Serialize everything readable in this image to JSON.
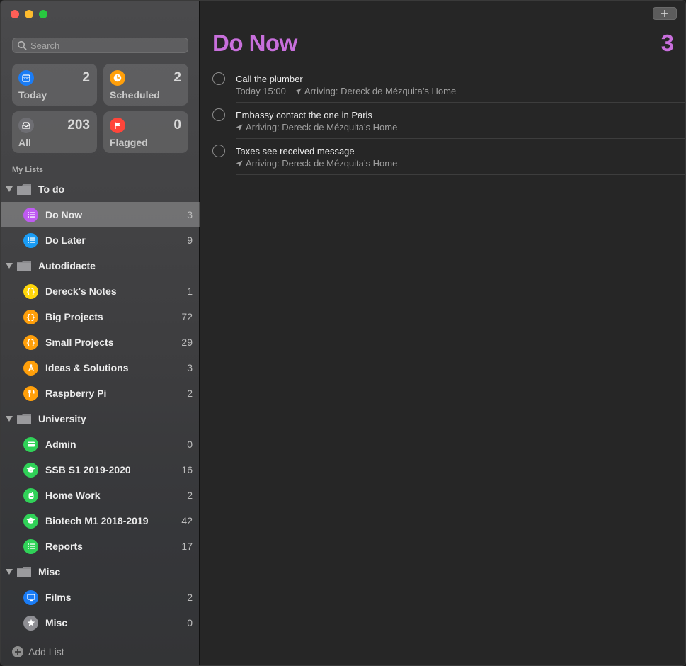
{
  "search": {
    "placeholder": "Search"
  },
  "smart_lists": [
    {
      "label": "Today",
      "count": "2",
      "color": "#1a7cf5",
      "icon": "calendar-icon"
    },
    {
      "label": "Scheduled",
      "count": "2",
      "color": "#ff9f0a",
      "icon": "clock-icon"
    },
    {
      "label": "All",
      "count": "203",
      "color": "#6e6e73",
      "icon": "tray-icon"
    },
    {
      "label": "Flagged",
      "count": "0",
      "color": "#ff453a",
      "icon": "flag-icon"
    }
  ],
  "my_lists_header": "My Lists",
  "groups": [
    {
      "label": "To do",
      "lists": [
        {
          "label": "Do Now",
          "count": "3",
          "color": "#bf5af2",
          "icon": "list-bullet-icon",
          "selected": true
        },
        {
          "label": "Do Later",
          "count": "9",
          "color": "#1a9cf5",
          "icon": "list-bullet-icon"
        }
      ]
    },
    {
      "label": "Autodidacte",
      "lists": [
        {
          "label": "Dereck's Notes",
          "count": "1",
          "color": "#ffd60a",
          "icon": "braces-icon"
        },
        {
          "label": "Big Projects",
          "count": "72",
          "color": "#ff9f0a",
          "icon": "braces-icon"
        },
        {
          "label": "Small Projects",
          "count": "29",
          "color": "#ff9f0a",
          "icon": "braces-icon"
        },
        {
          "label": "Ideas & Solutions",
          "count": "3",
          "color": "#ff9f0a",
          "icon": "compass-icon"
        },
        {
          "label": "Raspberry Pi",
          "count": "2",
          "color": "#ff9f0a",
          "icon": "utensils-icon"
        }
      ]
    },
    {
      "label": "University",
      "lists": [
        {
          "label": "Admin",
          "count": "0",
          "color": "#30d158",
          "icon": "card-icon"
        },
        {
          "label": "SSB S1 2019-2020",
          "count": "16",
          "color": "#30d158",
          "icon": "graduation-cap-icon"
        },
        {
          "label": "Home Work",
          "count": "2",
          "color": "#30d158",
          "icon": "backpack-icon"
        },
        {
          "label": "Biotech M1 2018-2019",
          "count": "42",
          "color": "#30d158",
          "icon": "graduation-cap-icon"
        },
        {
          "label": "Reports",
          "count": "17",
          "color": "#30d158",
          "icon": "list-bullet-icon"
        }
      ]
    },
    {
      "label": "Misc",
      "lists": [
        {
          "label": "Films",
          "count": "2",
          "color": "#1a7cf5",
          "icon": "tv-icon"
        },
        {
          "label": "Misc",
          "count": "0",
          "color": "#8e8e93",
          "icon": "star-icon"
        }
      ]
    }
  ],
  "add_list_label": "Add List",
  "main": {
    "title": "Do Now",
    "count": "3",
    "accent": "#c86fdc",
    "tasks": [
      {
        "title": "Call the plumber",
        "when": "Today 15:00",
        "location": "Arriving: Dereck de Mézquita’s Home"
      },
      {
        "title": "Embassy contact the one in Paris",
        "when": "",
        "location": "Arriving: Dereck de Mézquita’s Home"
      },
      {
        "title": "Taxes see received message",
        "when": "",
        "location": "Arriving: Dereck de Mézquita’s Home"
      }
    ]
  }
}
